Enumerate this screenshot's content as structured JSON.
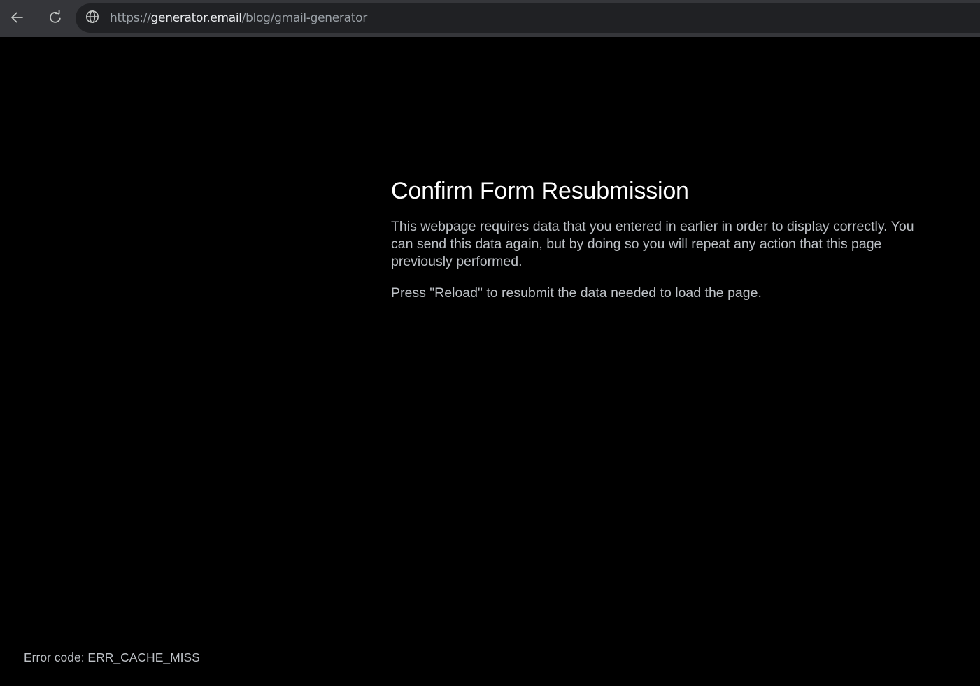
{
  "browser": {
    "url_scheme": "https://",
    "url_host": "generator.email",
    "url_path": "/blog/gmail-generator",
    "back_icon": "arrow-left-icon",
    "reload_icon": "reload-icon",
    "site_info_icon": "globe-icon"
  },
  "page": {
    "title": "Confirm Form Resubmission",
    "message": "This webpage requires data that you entered in earlier in order to display correctly. You can send this data again, but by doing so you will repeat any action that this page previously performed.",
    "instruction": "Press \"Reload\" to resubmit the data needed to load the page.",
    "error_code": "Error code: ERR_CACHE_MISS"
  },
  "colors": {
    "page_background": "#000000",
    "toolbar_background": "#35363a",
    "omnibox_background": "#202124",
    "heading_text": "#ffffff",
    "body_text": "#bdc1c6"
  }
}
